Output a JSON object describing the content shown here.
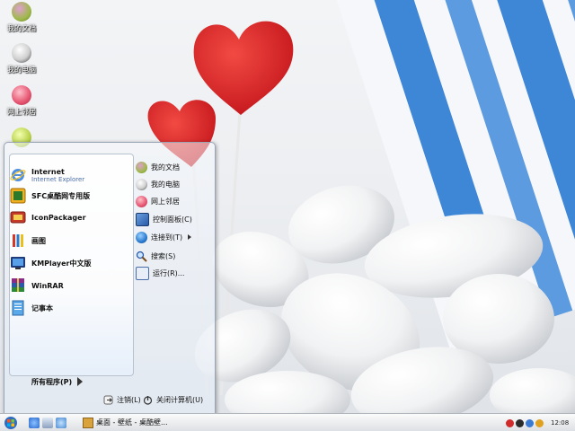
{
  "desktop_icons": [
    {
      "label": "我的文档",
      "icon": "folder-candy-icon",
      "color": "#9fb94a"
    },
    {
      "label": "我的电脑",
      "icon": "computer-candy-icon",
      "color": "#5a5a5a"
    },
    {
      "label": "网上邻居",
      "icon": "network-candy-icon",
      "color": "#e5536f"
    },
    {
      "label": "",
      "icon": "recycle-candy-icon",
      "color": "#b8d24a"
    }
  ],
  "start_menu": {
    "pinned": [
      {
        "title": "Internet",
        "subtitle": "Internet Explorer",
        "icon": "internet-explorer-icon"
      },
      {
        "title": "SFC桌酷网专用版",
        "icon": "sfc-app-icon"
      },
      {
        "title": "IconPackager",
        "icon": "iconpackager-icon"
      }
    ],
    "recent": [
      {
        "title": "画图",
        "icon": "paint-icon"
      },
      {
        "title": "KMPlayer中文版",
        "icon": "kmplayer-icon"
      },
      {
        "title": "WinRAR",
        "icon": "winrar-icon"
      },
      {
        "title": "记事本",
        "icon": "notepad-icon"
      }
    ],
    "all_programs": "所有程序(P)",
    "right_items": [
      {
        "label": "我的文档",
        "icon": "my-documents-icon"
      },
      {
        "label": "我的电脑",
        "icon": "my-computer-icon"
      },
      {
        "label": "网上邻居",
        "icon": "network-places-icon"
      },
      {
        "label": "控制面板(C)",
        "icon": "control-panel-icon"
      },
      {
        "label": "连接到(T)",
        "icon": "connect-to-icon"
      },
      {
        "label": "搜索(S)",
        "icon": "search-icon"
      },
      {
        "label": "运行(R)...",
        "icon": "run-icon"
      }
    ],
    "logoff": "注销(L)",
    "shutdown": "关闭计算机(U)"
  },
  "taskbar": {
    "task_label": "桌面 - 壁纸 - 桌酷壁...",
    "clock": "12:08"
  },
  "colors": {
    "accent_blue": "#3e86d6",
    "heart_red": "#d8282c"
  }
}
